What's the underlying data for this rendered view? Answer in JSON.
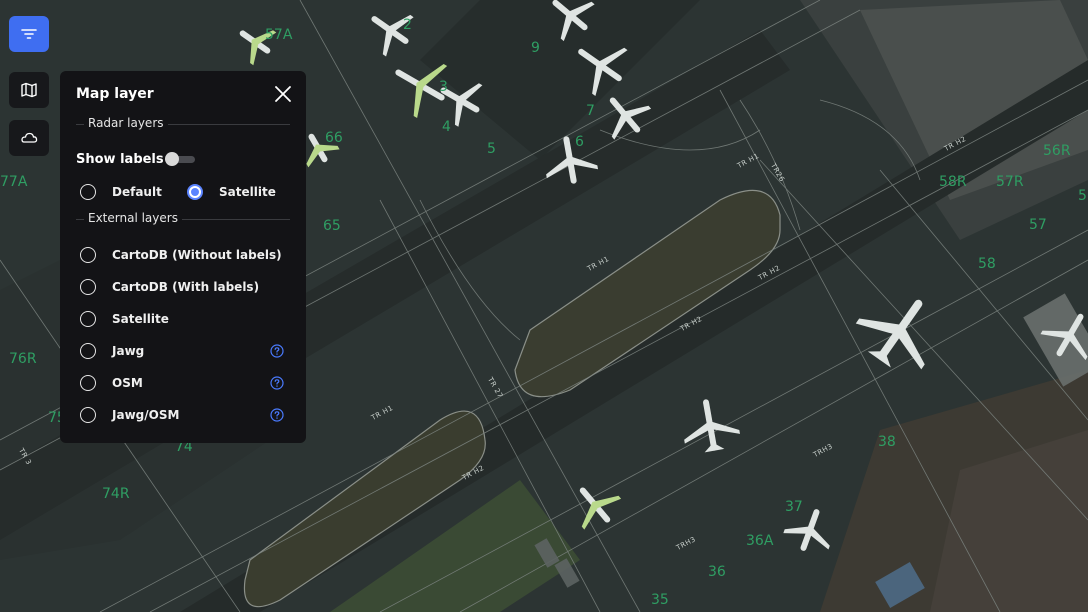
{
  "map": {
    "stand_labels": [
      {
        "text": "57A"
      },
      {
        "text": "2"
      },
      {
        "text": "9"
      },
      {
        "text": "3"
      },
      {
        "text": "7"
      },
      {
        "text": "4"
      },
      {
        "text": "6"
      },
      {
        "text": "66"
      },
      {
        "text": "5"
      },
      {
        "text": "77A"
      },
      {
        "text": "65"
      },
      {
        "text": "76R"
      },
      {
        "text": "75"
      },
      {
        "text": "74"
      },
      {
        "text": "74R"
      },
      {
        "text": "56R"
      },
      {
        "text": "58R"
      },
      {
        "text": "57R"
      },
      {
        "text": "5"
      },
      {
        "text": "57"
      },
      {
        "text": "58"
      },
      {
        "text": "38"
      },
      {
        "text": "37"
      },
      {
        "text": "36A"
      },
      {
        "text": "36"
      },
      {
        "text": "35"
      }
    ],
    "taxiway_labels": [
      {
        "text": "TR H1"
      },
      {
        "text": "TR H2"
      },
      {
        "text": "TR H1"
      },
      {
        "text": "TR H2"
      },
      {
        "text": "TR H2"
      },
      {
        "text": "TR 27"
      },
      {
        "text": "TR H1"
      },
      {
        "text": "TR H2"
      },
      {
        "text": "TRH3"
      },
      {
        "text": "TRH3"
      },
      {
        "text": "TR 3"
      },
      {
        "text": "TR26"
      }
    ]
  },
  "toolbar": {
    "filter_icon": "filter-icon",
    "map_icon": "map-icon",
    "weather_icon": "cloud-icon"
  },
  "panel": {
    "title": "Map layer",
    "close_icon": "close-icon",
    "radar_section": "Radar layers",
    "show_labels": "Show labels",
    "show_labels_on": false,
    "radar_options": [
      {
        "label": "Default",
        "checked": false
      },
      {
        "label": "Satellite",
        "checked": true
      }
    ],
    "external_section": "External layers",
    "external_options": [
      {
        "label": "CartoDB (Without labels)",
        "help": false
      },
      {
        "label": "CartoDB (With labels)",
        "help": false
      },
      {
        "label": "Satellite",
        "help": false
      },
      {
        "label": "Jawg",
        "help": true
      },
      {
        "label": "OSM",
        "help": true
      },
      {
        "label": "Jawg/OSM",
        "help": true
      }
    ]
  },
  "colors": {
    "accent": "#3f6ef1",
    "panel_bg": "#131316",
    "stand_label": "#2f9e63",
    "help_icon": "#4a7bff"
  }
}
